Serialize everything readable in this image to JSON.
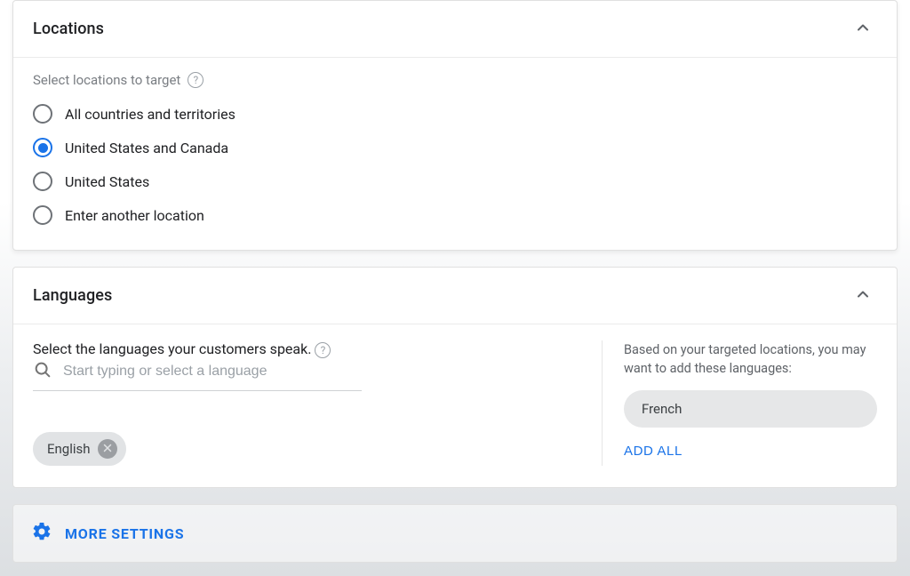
{
  "locations": {
    "title": "Locations",
    "hint": "Select locations to target",
    "options": [
      {
        "label": "All countries and territories",
        "selected": false
      },
      {
        "label": "United States and Canada",
        "selected": true
      },
      {
        "label": "United States",
        "selected": false
      },
      {
        "label": "Enter another location",
        "selected": false
      }
    ]
  },
  "languages": {
    "title": "Languages",
    "hint": "Select the languages your customers speak.",
    "search_placeholder": "Start typing or select a language",
    "selected": [
      {
        "label": "English"
      }
    ],
    "suggest_intro": "Based on your targeted locations, you may want to add these languages:",
    "suggestions": [
      {
        "label": "French"
      }
    ],
    "add_all_label": "ADD ALL"
  },
  "more_settings_label": "MORE SETTINGS"
}
